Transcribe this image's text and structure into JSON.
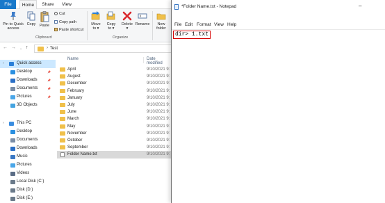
{
  "ribbon": {
    "tabs": [
      "File",
      "Home",
      "Share",
      "View"
    ],
    "pin_label": [
      "Pin to Quick",
      "access"
    ],
    "copy_label": "Copy",
    "paste_label": "Paste",
    "cut_label": "Cut",
    "copy_path_label": "Copy path",
    "paste_shortcut_label": "Paste shortcut",
    "move_to_label": [
      "Move",
      "to ▾"
    ],
    "copy_to_label": [
      "Copy",
      "to ▾"
    ],
    "delete_label": [
      "Delete",
      "▾"
    ],
    "rename_label": "Rename",
    "new_folder_label": [
      "New",
      "folder"
    ],
    "clipboard_group": "Clipboard",
    "organize_group": "Organize",
    "colors": {
      "file_tab": "#1979ca",
      "delete_x": "#d9262b"
    }
  },
  "address": {
    "crumb": "Test"
  },
  "nav": {
    "items": [
      {
        "label": "Quick access",
        "icon": "star-icon",
        "color": "#2b7fd8",
        "pin": false,
        "chev": true,
        "selected": true
      },
      {
        "label": "Desktop",
        "icon": "desktop-icon",
        "color": "#2a8fe0",
        "pin": true
      },
      {
        "label": "Downloads",
        "icon": "download-icon",
        "color": "#2a6fc6",
        "pin": true
      },
      {
        "label": "Documents",
        "icon": "documents-icon",
        "color": "#7a8da6",
        "pin": true
      },
      {
        "label": "Pictures",
        "icon": "pictures-icon",
        "color": "#4aa6e8",
        "pin": true
      },
      {
        "label": "3D Objects",
        "icon": "3d-objects-icon",
        "color": "#44a3e0",
        "pin": false
      },
      {
        "label": "This PC",
        "icon": "computer-icon",
        "color": "#3b8de0",
        "pin": false,
        "chev": true
      },
      {
        "label": "Desktop",
        "icon": "desktop-icon",
        "color": "#2a8fe0",
        "pin": false
      },
      {
        "label": "Documents",
        "icon": "documents-icon",
        "color": "#7a8da6",
        "pin": false
      },
      {
        "label": "Downloads",
        "icon": "download-icon",
        "color": "#2a6fc6",
        "pin": false
      },
      {
        "label": "Music",
        "icon": "music-icon",
        "color": "#3a78c4",
        "pin": false
      },
      {
        "label": "Pictures",
        "icon": "pictures-icon",
        "color": "#4aa6e8",
        "pin": false
      },
      {
        "label": "Videos",
        "icon": "videos-icon",
        "color": "#5a6c85",
        "pin": false
      },
      {
        "label": "Local Disk (C:)",
        "icon": "disk-icon",
        "color": "#6a7a8a",
        "pin": false
      },
      {
        "label": "Disk (D:)",
        "icon": "disk-icon",
        "color": "#6a7a8a",
        "pin": false
      },
      {
        "label": "Disk (E:)",
        "icon": "disk-icon",
        "color": "#6a7a8a",
        "pin": false
      }
    ]
  },
  "files": {
    "col_name": "Name",
    "col_date": "Date modified",
    "rows": [
      {
        "name": "April",
        "date": "9/10/2021 9:",
        "type": "folder"
      },
      {
        "name": "August",
        "date": "9/10/2021 9:",
        "type": "folder"
      },
      {
        "name": "December",
        "date": "9/10/2021 9:",
        "type": "folder"
      },
      {
        "name": "February",
        "date": "9/10/2021 9:",
        "type": "folder"
      },
      {
        "name": "January",
        "date": "9/10/2021 9:",
        "type": "folder"
      },
      {
        "name": "July",
        "date": "9/10/2021 9:",
        "type": "folder"
      },
      {
        "name": "June",
        "date": "9/10/2021 9:",
        "type": "folder"
      },
      {
        "name": "March",
        "date": "9/10/2021 9:",
        "type": "folder"
      },
      {
        "name": "May",
        "date": "9/10/2021 9:",
        "type": "folder"
      },
      {
        "name": "November",
        "date": "9/10/2021 9:",
        "type": "folder"
      },
      {
        "name": "October",
        "date": "9/10/2021 9:",
        "type": "folder"
      },
      {
        "name": "September",
        "date": "9/10/2021 9:",
        "type": "folder"
      },
      {
        "name": "Folder Name.txt",
        "date": "9/10/2021 9:",
        "type": "txt",
        "selected": true
      }
    ]
  },
  "notepad": {
    "title": "*Folder Name.txt - Notepad",
    "menus": [
      "File",
      "Edit",
      "Format",
      "View",
      "Help"
    ],
    "content": "dir> 1.txt",
    "highlight_color": "#d60000"
  }
}
